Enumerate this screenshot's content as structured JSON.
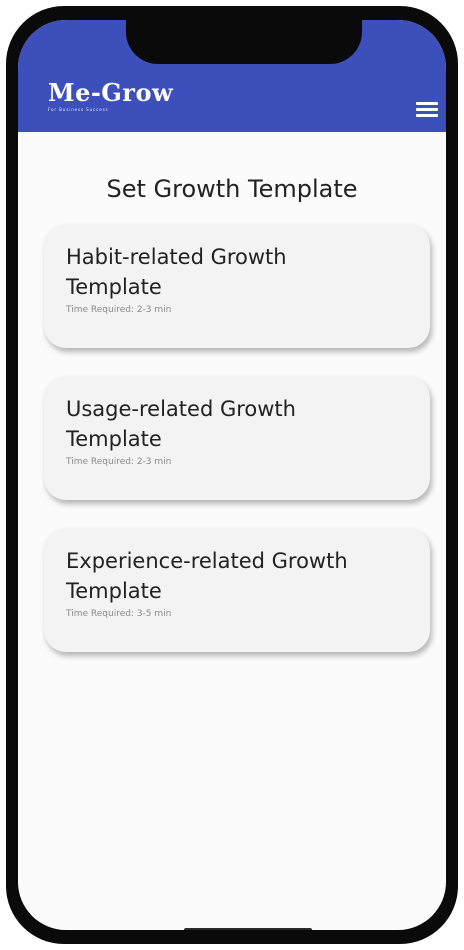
{
  "header": {
    "logo_text": "Me-Grow",
    "logo_tagline": "For Business Success",
    "menu_icon": "hamburger-menu-icon",
    "color": "#3d4fba"
  },
  "main": {
    "title": "Set Growth Template",
    "templates": [
      {
        "title_line1": "Habit-related Growth",
        "title_line2": "Template",
        "time": "Time Required: 2-3 min"
      },
      {
        "title_line1": "Usage-related Growth",
        "title_line2": "Template",
        "time": "Time Required: 2-3 min"
      },
      {
        "title_line1": "Experience-related Growth",
        "title_line2": "Template",
        "time": "Time Required: 3-5 min"
      }
    ]
  }
}
